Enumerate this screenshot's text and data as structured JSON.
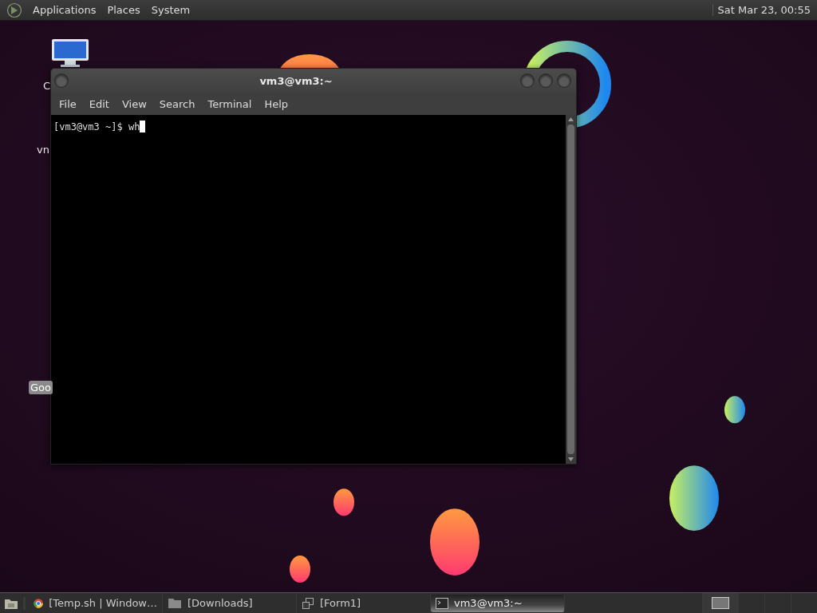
{
  "top_panel": {
    "menus": [
      "Applications",
      "Places",
      "System"
    ],
    "clock": "Sat Mar 23, 00:55"
  },
  "desktop_icons": [
    {
      "label": "C",
      "kind": "computer",
      "selected": false
    },
    {
      "label": "vn",
      "kind": "text",
      "selected": false
    },
    {
      "label": "Goo",
      "kind": "text",
      "selected": true
    }
  ],
  "terminal": {
    "title": "vm3@vm3:~",
    "menus": [
      "File",
      "Edit",
      "View",
      "Search",
      "Terminal",
      "Help"
    ],
    "prompt": "[vm3@vm3 ~]$ wh"
  },
  "taskbar": {
    "tasks": [
      {
        "label": "[Temp.sh | Window…",
        "kind": "browser",
        "selected": false
      },
      {
        "label": "[Downloads]",
        "kind": "folder",
        "selected": false
      },
      {
        "label": "[Form1]",
        "kind": "window",
        "selected": false
      },
      {
        "label": "vm3@vm3:~",
        "kind": "terminal",
        "selected": true
      }
    ],
    "workspaces": [
      {
        "selected": true
      },
      {
        "selected": false
      },
      {
        "selected": false
      },
      {
        "selected": false
      }
    ]
  }
}
